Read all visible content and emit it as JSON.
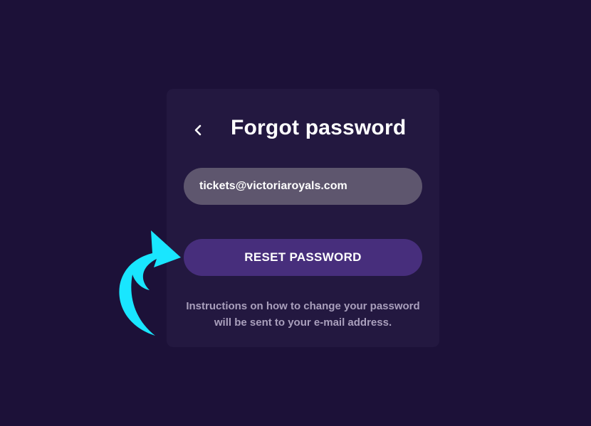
{
  "page": {
    "title": "Forgot password",
    "back_icon": "chevron-left-icon"
  },
  "form": {
    "email_value": "tickets@victoriaroyals.com",
    "reset_button_label": "RESET PASSWORD",
    "instructions_line1": "Instructions on how to change your password",
    "instructions_line2": "will be sent to your e-mail address."
  },
  "annotation": {
    "arrow_icon": "curved-arrow-icon",
    "arrow_color": "#19e6ff"
  },
  "colors": {
    "background": "#1c1138",
    "card": "#231840",
    "input": "#5e566e",
    "button": "#472e7c"
  }
}
